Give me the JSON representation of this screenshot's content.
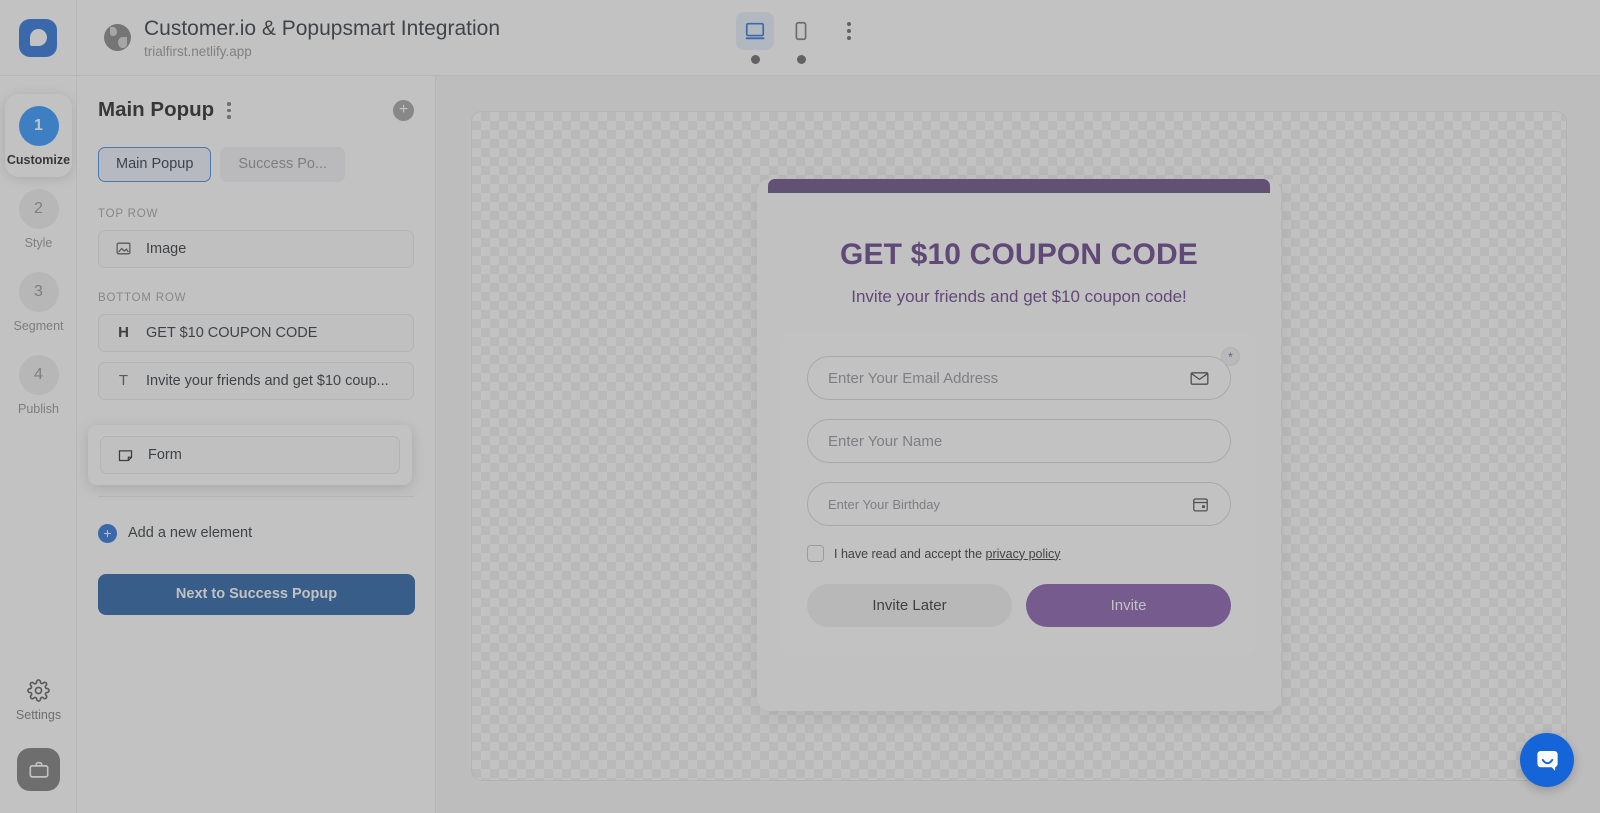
{
  "header": {
    "logo_icon": "popupsmart-logo-icon",
    "globe_icon": "globe-icon",
    "title": "Customer.io & Popupsmart Integration",
    "url": "trialfirst.netlify.app",
    "devices": [
      {
        "name": "desktop",
        "icon": "desktop-icon",
        "active": true
      },
      {
        "name": "mobile",
        "icon": "mobile-icon",
        "active": false
      }
    ],
    "more_icon": "more-vertical-icon"
  },
  "rail": {
    "steps": [
      {
        "number": "1",
        "label": "Customize",
        "active": true
      },
      {
        "number": "2",
        "label": "Style",
        "active": false
      },
      {
        "number": "3",
        "label": "Segment",
        "active": false
      },
      {
        "number": "4",
        "label": "Publish",
        "active": false
      }
    ],
    "settings_label": "Settings",
    "settings_icon": "gear-icon",
    "briefcase_icon": "briefcase-icon"
  },
  "sidebar": {
    "title": "Main Popup",
    "title_menu_icon": "more-vertical-icon",
    "add_icon": "plus-circle-icon",
    "tabs": [
      {
        "label": "Main Popup",
        "active": true
      },
      {
        "label": "Success Po...",
        "active": false
      }
    ],
    "top_row_label": "TOP ROW",
    "top_row_elements": [
      {
        "label": "Image",
        "icon": "image-icon"
      }
    ],
    "bottom_row_label": "BOTTOM ROW",
    "bottom_row_elements": [
      {
        "label": "GET $10 COUPON CODE",
        "icon": "heading-icon",
        "icon_text": "H"
      },
      {
        "label": "Invite your friends and get $10 coup...",
        "icon": "text-icon",
        "icon_text": "T"
      },
      {
        "label": "Form",
        "icon": "form-icon",
        "highlighted": true
      }
    ],
    "add_element_label": "Add a new element",
    "add_element_icon": "plus-circle-icon",
    "next_button": "Next to Success Popup"
  },
  "popup": {
    "heading": "GET $10 COUPON CODE",
    "subheading": "Invite your friends and get $10 coupon code!",
    "fields": [
      {
        "placeholder": "Enter Your Email Address",
        "icon": "envelope-icon",
        "required_badge": "*"
      },
      {
        "placeholder": "Enter Your Name",
        "icon": ""
      },
      {
        "placeholder": "Enter Your Birthday",
        "icon": "calendar-icon"
      }
    ],
    "consent_prefix": "I have read and accept the ",
    "consent_link": "privacy policy",
    "buttons": [
      {
        "label": "Invite Later",
        "style": "secondary"
      },
      {
        "label": "Invite",
        "style": "primary"
      }
    ]
  },
  "chat": {
    "icon": "intercom-chat-icon"
  },
  "colors": {
    "brand_blue": "#1565d8",
    "next_button_blue": "#12519e",
    "popup_purple": "#59307f",
    "popup_bar_purple": "#593f77",
    "invite_button_purple": "#7b4fa5",
    "step_active_blue": "#1a8cff"
  }
}
